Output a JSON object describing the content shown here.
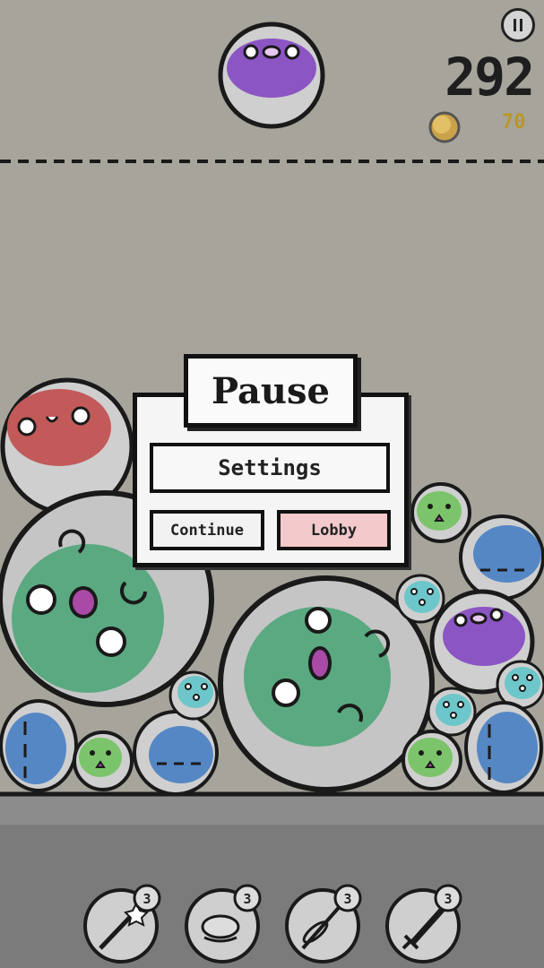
{
  "hud": {
    "score": "292",
    "coins": "70",
    "pause_icon": "pause-icon",
    "coin_icon": "coin-icon"
  },
  "next_ball": {
    "color": "#8b55c4",
    "type": "purple-blob"
  },
  "pause_menu": {
    "title": "Pause",
    "settings_label": "Settings",
    "continue_label": "Continue",
    "lobby_label": "Lobby"
  },
  "items": [
    {
      "icon": "magic-wand-icon",
      "count": "3"
    },
    {
      "icon": "blob-hand-icon",
      "count": "3"
    },
    {
      "icon": "needle-icon",
      "count": "3"
    },
    {
      "icon": "sword-icon",
      "count": "3"
    }
  ],
  "colors": {
    "background": "#a7a49c",
    "floor": "#7b7b7b",
    "green": "#5aa981",
    "blue": "#5587c4",
    "purple": "#8b55c4",
    "red": "#c25a5a",
    "cyan": "#6dc6c9",
    "lime": "#7cc46b",
    "lobby_button": "#f3c9cc"
  }
}
